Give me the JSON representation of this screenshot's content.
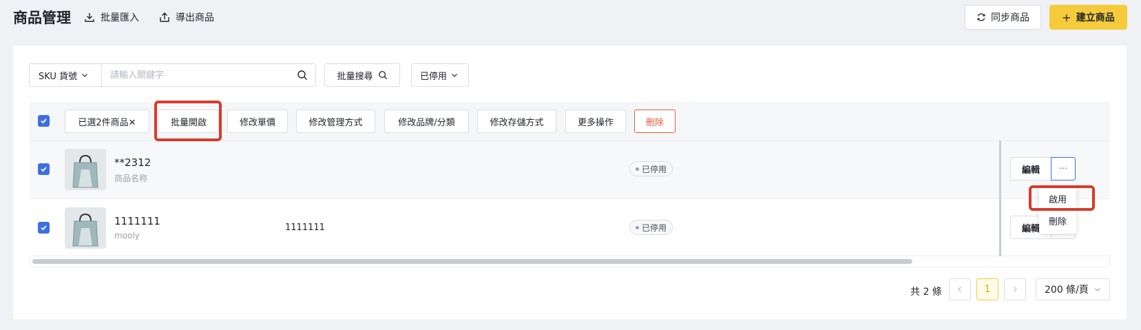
{
  "header": {
    "title": "商品管理",
    "import_label": "批量匯入",
    "export_label": "導出商品",
    "sync_label": "同步商品",
    "create_label": "建立商品"
  },
  "filters": {
    "field_select": "SKU 貨號",
    "search_placeholder": "請輸入關鍵字",
    "batch_search_label": "批量搜尋",
    "status_select": "已停用"
  },
  "bulk_actions": {
    "selected_label": "已選2件商品✕",
    "batch_enable": "批量開啟",
    "edit_price": "修改單價",
    "edit_management": "修改管理方式",
    "edit_brand_category": "修改品牌/分類",
    "edit_storage": "修改存儲方式",
    "more_actions": "更多操作",
    "delete": "刪除"
  },
  "rows": [
    {
      "sku": "**2312",
      "name": "商品名称",
      "code": "",
      "status": "已停用",
      "edit_label": "編輯",
      "more_label": "···",
      "checked": true
    },
    {
      "sku": "1111111",
      "name": "mooly",
      "code": "1111111",
      "status": "已停用",
      "edit_label": "編輯",
      "more_label": "",
      "checked": true
    }
  ],
  "dropdown": {
    "enable": "啟用",
    "delete": "刪除"
  },
  "pagination": {
    "total": "共 2 條",
    "current_page": "1",
    "page_size": "200 條/頁"
  },
  "colors": {
    "accent_yellow": "#f5cb3c",
    "checkbox_blue": "#3d6fe0",
    "danger_red": "#e25b3a",
    "highlight_red": "#d93a2b"
  }
}
